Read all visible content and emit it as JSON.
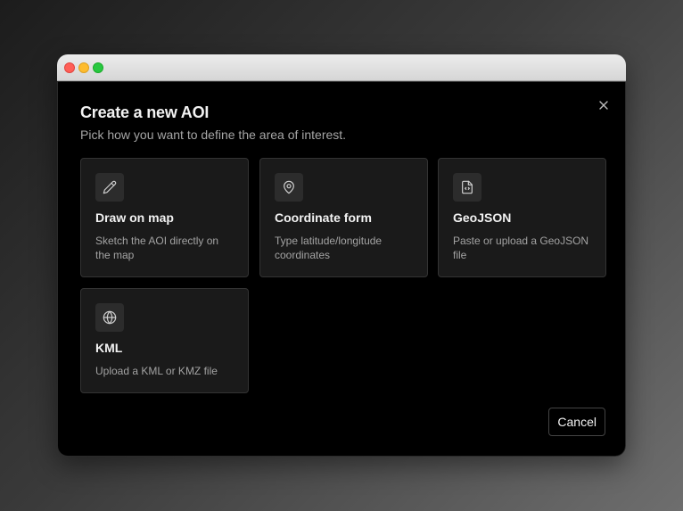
{
  "dialog": {
    "title": "Create a new AOI",
    "subtitle": "Pick how you want to define the area of interest.",
    "close_icon": "close-icon",
    "options": [
      {
        "icon": "pencil-icon",
        "title": "Draw on map",
        "description": "Sketch the AOI directly on the map"
      },
      {
        "icon": "map-pin-icon",
        "title": "Coordinate form",
        "description": "Type latitude/longitude coordinates"
      },
      {
        "icon": "file-code-icon",
        "title": "GeoJSON",
        "description": "Paste or upload a GeoJSON file"
      },
      {
        "icon": "globe-icon",
        "title": "KML",
        "description": "Upload a KML or KMZ file"
      }
    ],
    "cancel_label": "Cancel"
  },
  "window": {
    "traffic_lights": [
      "close",
      "minimize",
      "maximize"
    ]
  },
  "colors": {
    "dialog_bg": "#000000",
    "card_bg": "#1a1a1a",
    "card_border": "#333333",
    "text_primary": "#f2f2f2",
    "text_secondary": "#a6a6a6"
  }
}
